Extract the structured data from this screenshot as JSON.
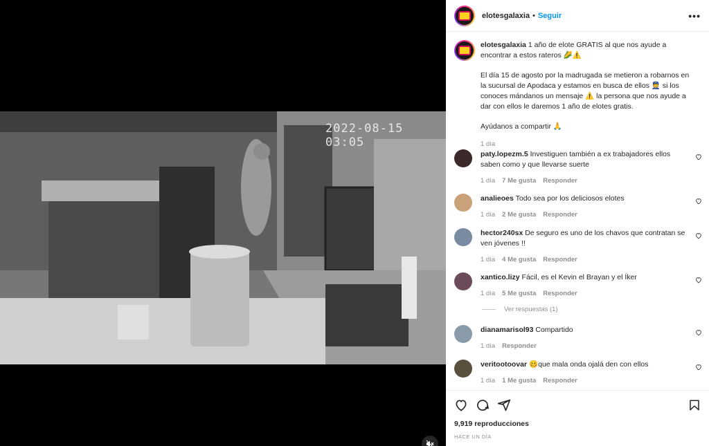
{
  "video": {
    "timestamp": "2022-08-15 03:05"
  },
  "header": {
    "username": "elotesgalaxia",
    "separator": "•",
    "follow_label": "Seguir",
    "more_label": "•••"
  },
  "caption": {
    "username": "elotesgalaxia",
    "line1": "1 año de elote GRATIS al que nos ayude a encontrar a estos rateros 🌽⚠️",
    "para2": "El día 15 de agosto por la madrugada se metieron a robarnos en la sucursal de Apodaca y estamos en busca de ellos 👮 si los conoces mándanos un mensaje ⚠️ la persona que nos ayude a dar con ellos le daremos 1 año de elotes gratis.",
    "para3": "Ayúdanos a compartir 🙏",
    "time": "1 día"
  },
  "comments": [
    {
      "username": "paty.lopezm.5",
      "text": "Investiguen también a ex trabajadores ellos saben como y que llevarse suerte",
      "time": "1 día",
      "likes": "7 Me gusta",
      "reply": "Responder",
      "avatar_color": "#3a2a2a"
    },
    {
      "username": "analieoes",
      "text": "Todo sea por los deliciosos elotes",
      "time": "1 día",
      "likes": "2 Me gusta",
      "reply": "Responder",
      "avatar_color": "#c9a27a"
    },
    {
      "username": "hector240sx",
      "text": "De seguro es uno de los chavos que contratan se ven jóvenes !!",
      "time": "1 día",
      "likes": "4 Me gusta",
      "reply": "Responder",
      "avatar_color": "#7a8aa0"
    },
    {
      "username": "xantico.lizy",
      "text": "Fácil, es el Kevin el Brayan y el Íker",
      "time": "1 día",
      "likes": "5 Me gusta",
      "reply": "Responder",
      "avatar_color": "#6b4a5a"
    },
    {
      "username": "dianamarisol93",
      "text": "Compartido",
      "time": "1 día",
      "likes": "",
      "reply": "Responder",
      "avatar_color": "#8a9aaa"
    },
    {
      "username": "veritootoovar",
      "text": "🥴que mala onda ojalá den con ellos",
      "time": "1 día",
      "likes": "1 Me gusta",
      "reply": "Responder",
      "avatar_color": "#5a5040"
    }
  ],
  "replies_label": "Ver respuestas (1)",
  "footer": {
    "views": "9,919 reproducciones",
    "posted": "HACE UN DÍA"
  },
  "colors": {
    "accent": "#0095f6",
    "muted": "#8e8e8e",
    "text": "#262626"
  }
}
